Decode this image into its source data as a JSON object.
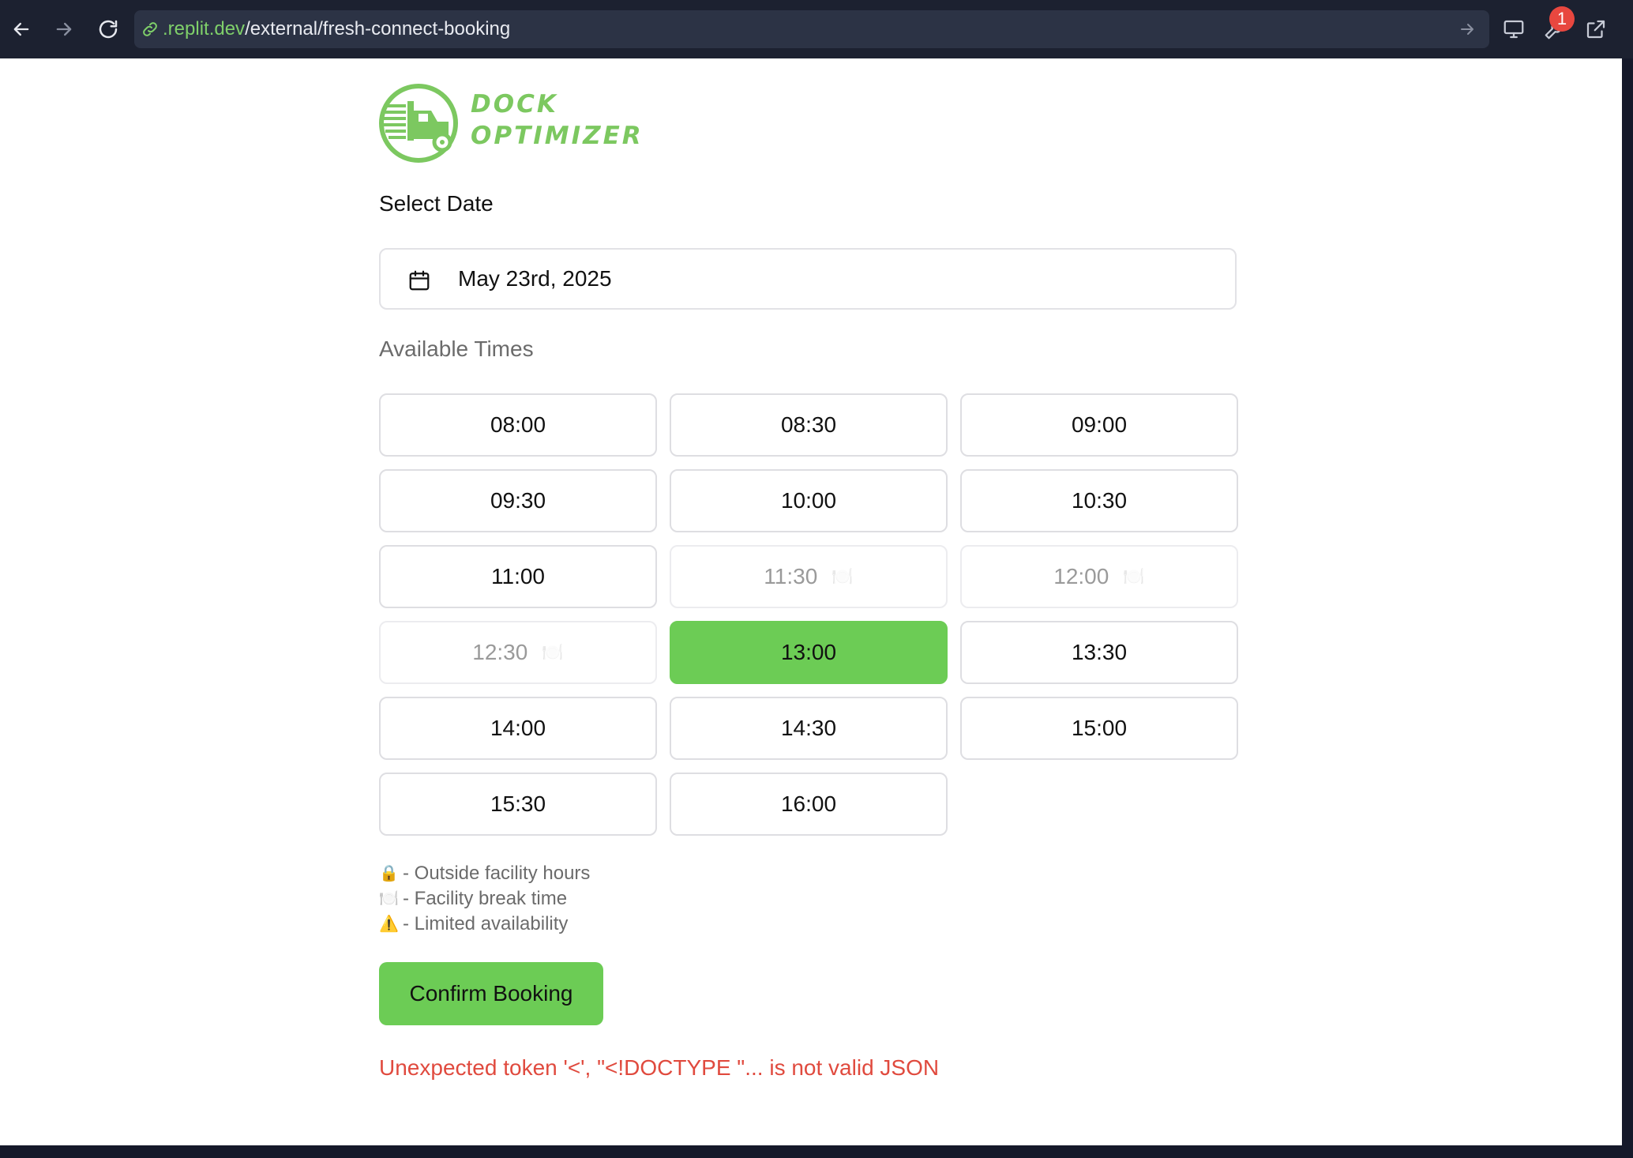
{
  "browser": {
    "url_domain": ".replit.dev",
    "url_path": "/external/fresh-connect-booking",
    "badge_count": "1"
  },
  "logo": {
    "line1": "DOCK",
    "line2": "OPTIMIZER"
  },
  "booking": {
    "select_date_label": "Select Date",
    "date_value": "May 23rd, 2025",
    "available_times_label": "Available Times",
    "slots": [
      {
        "time": "08:00",
        "state": "available"
      },
      {
        "time": "08:30",
        "state": "available"
      },
      {
        "time": "09:00",
        "state": "available"
      },
      {
        "time": "09:30",
        "state": "available"
      },
      {
        "time": "10:00",
        "state": "available"
      },
      {
        "time": "10:30",
        "state": "available"
      },
      {
        "time": "11:00",
        "state": "available"
      },
      {
        "time": "11:30",
        "state": "break",
        "icon": "🍽️"
      },
      {
        "time": "12:00",
        "state": "break",
        "icon": "🍽️"
      },
      {
        "time": "12:30",
        "state": "break",
        "icon": "🍽️"
      },
      {
        "time": "13:00",
        "state": "selected"
      },
      {
        "time": "13:30",
        "state": "available"
      },
      {
        "time": "14:00",
        "state": "available"
      },
      {
        "time": "14:30",
        "state": "available"
      },
      {
        "time": "15:00",
        "state": "available"
      },
      {
        "time": "15:30",
        "state": "available"
      },
      {
        "time": "16:00",
        "state": "available"
      }
    ],
    "legend": [
      {
        "icon": "🔒",
        "text": "- Outside facility hours"
      },
      {
        "icon": "🍽️",
        "text": "- Facility break time"
      },
      {
        "icon": "⚠️",
        "text": "- Limited availability"
      }
    ],
    "confirm_label": "Confirm Booking",
    "error_message": "Unexpected token '<', \"<!DOCTYPE \"... is not valid JSON"
  },
  "colors": {
    "accent_green": "#6ccc55",
    "error_red": "#e04a3e",
    "chrome_bg": "#1c2130"
  }
}
